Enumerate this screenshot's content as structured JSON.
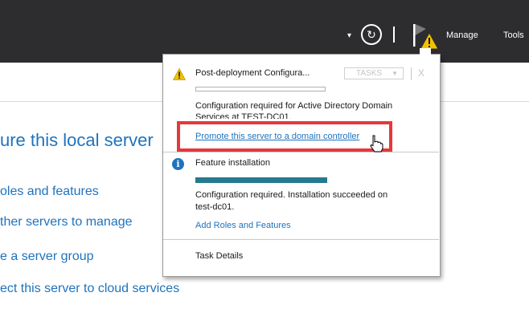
{
  "toolbar": {
    "dropdown_glyph": "▾",
    "refresh_glyph": "↻",
    "manage_label": "Manage",
    "tools_label": "Tools",
    "icons": [
      "chevron-down-icon",
      "refresh-icon",
      "notification-flag-icon",
      "warning-icon"
    ]
  },
  "main": {
    "heading": "ure this local server",
    "links": [
      "oles and features",
      "ther servers to manage",
      "e a server group",
      "ect this server to cloud services"
    ]
  },
  "notifications": {
    "task1": {
      "title": "Post-deployment Configura...",
      "tasks_label": "TASKS",
      "tasks_arrow": "▼",
      "close_label": "X",
      "progress": 0,
      "desc_line1": "Configuration required for Active Directory Domain",
      "desc_line2": "Services at TEST-DC01.",
      "link": "Promote this server to a domain controller"
    },
    "task2": {
      "title": "Feature installation",
      "info_glyph": "i",
      "progress": 1,
      "desc_line1": "Configuration required. Installation succeeded on",
      "desc_line2": "test-dc01.",
      "link": "Add Roles and Features"
    },
    "task_details": "Task Details"
  },
  "colors": {
    "toolbar_bg": "#2d2d30",
    "link_blue": "#1e73be",
    "progress_teal": "#26798e",
    "highlight_red": "#e5393b",
    "warning_yellow": "#f2c200"
  }
}
